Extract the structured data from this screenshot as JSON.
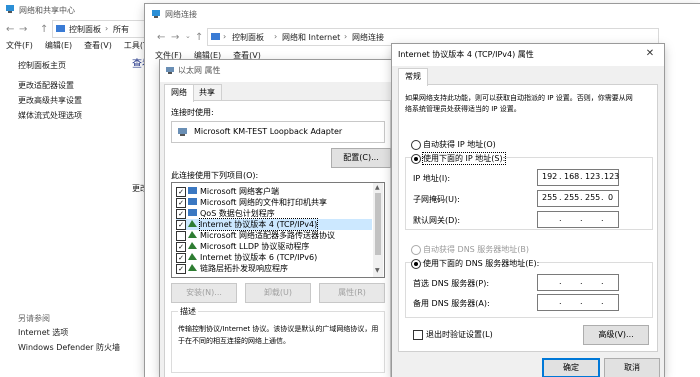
{
  "bg_window": {
    "title": "网络和共享中心",
    "path": [
      "控制面板",
      "所有"
    ],
    "menu": [
      "文件(F)",
      "编辑(E)",
      "查看(V)",
      "工具(T)"
    ],
    "links": [
      "控制面板主页",
      "更改适配器设置",
      "更改高级共享设置",
      "媒体流式处理选项"
    ],
    "partial_heading": "查看",
    "partial_text": "更改",
    "see_also": "另请参阅",
    "see_also_links": [
      "Internet 选项",
      "Windows Defender 防火墙"
    ]
  },
  "net_window": {
    "title": "网络连接",
    "path": [
      "控制面板",
      "网络和 Internet",
      "网络连接"
    ],
    "menu": [
      "文件(F)",
      "编辑(E)",
      "查看(V)"
    ]
  },
  "eth_dialog": {
    "title": "以太网 属性",
    "tabs": [
      "网络",
      "共享"
    ],
    "connect_using_label": "连接时使用:",
    "adapter_name": "Microsoft KM-TEST Loopback Adapter",
    "configure_btn": "配置(C)...",
    "items_label": "此连接使用下列项目(O):",
    "items": [
      {
        "checked": true,
        "label": "Microsoft 网络客户端",
        "icon": "client-icon"
      },
      {
        "checked": true,
        "label": "Microsoft 网络的文件和打印机共享",
        "icon": "share-icon"
      },
      {
        "checked": true,
        "label": "QoS 数据包计划程序",
        "icon": "qos-icon"
      },
      {
        "checked": true,
        "label": "Internet 协议版本 4 (TCP/IPv4)",
        "icon": "protocol-icon",
        "selected": true
      },
      {
        "checked": false,
        "label": "Microsoft 网络适配器多路传送器协议",
        "icon": "protocol-icon"
      },
      {
        "checked": true,
        "label": "Microsoft LLDP 协议驱动程序",
        "icon": "protocol-icon"
      },
      {
        "checked": true,
        "label": "Internet 协议版本 6 (TCP/IPv6)",
        "icon": "protocol-icon"
      },
      {
        "checked": true,
        "label": "链路层拓扑发现响应程序",
        "icon": "protocol-icon"
      }
    ],
    "install_btn": "安装(N)...",
    "uninstall_btn": "卸载(U)",
    "properties_btn": "属性(R)",
    "desc_label": "描述",
    "desc_text_1": "传输控制协议/Internet 协议。该协议是默认的广域网络协议，用",
    "desc_text_2": "于在不同的相互连接的网络上通信。"
  },
  "ipv4_dialog": {
    "title": "Internet 协议版本 4 (TCP/IPv4) 属性",
    "tab": "常规",
    "intro_1": "如果网络支持此功能，则可以获取自动指派的 IP 设置。否则，你需要从网",
    "intro_2": "络系统管理员处获得适当的 IP 设置。",
    "auto_ip": "自动获得 IP 地址(O)",
    "manual_ip": "使用下面的 IP 地址(S):",
    "ip_label": "IP 地址(I):",
    "ip_value": [
      "192",
      "168",
      "123",
      "123"
    ],
    "mask_label": "子网掩码(U):",
    "mask_value": [
      "255",
      "255",
      "255",
      "0"
    ],
    "gateway_label": "默认网关(D):",
    "auto_dns": "自动获得 DNS 服务器地址(B)",
    "manual_dns": "使用下面的 DNS 服务器地址(E):",
    "dns1_label": "首选 DNS 服务器(P):",
    "dns2_label": "备用 DNS 服务器(A):",
    "validate": "退出时验证设置(L)",
    "advanced_btn": "高级(V)...",
    "ok_btn": "确定",
    "cancel_btn": "取消"
  }
}
